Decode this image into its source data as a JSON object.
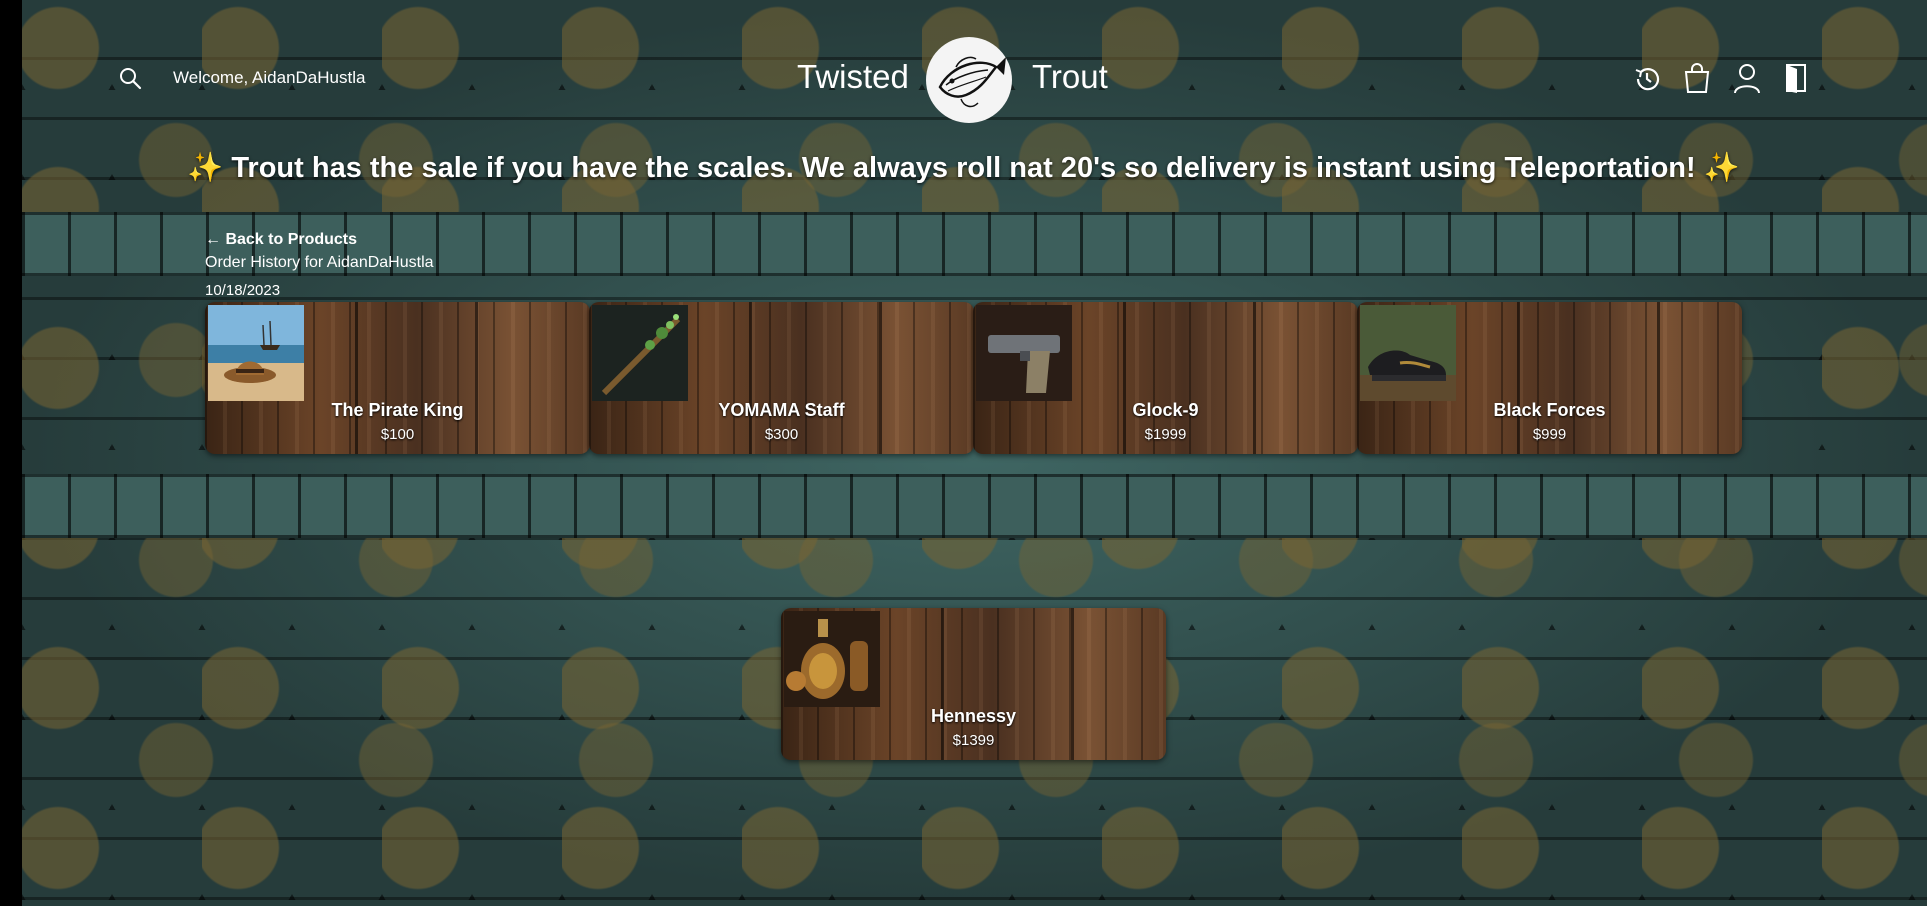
{
  "header": {
    "welcome": "Welcome, AidanDaHustla",
    "brand_left": "Twisted",
    "brand_right": "Trout",
    "icons": [
      "search-icon",
      "history-icon",
      "shopping-bag-icon",
      "user-icon",
      "logout-door-icon"
    ]
  },
  "tagline": "✨ Trout has the sale if you have the scales. We always roll nat 20's so delivery is instant using Teleportation! ✨",
  "nav": {
    "back_label": "← Back to Products",
    "history_title": "Order History for AidanDaHustla"
  },
  "order": {
    "date": "10/18/2023",
    "items": [
      {
        "name": "The Pirate King",
        "price": "$100"
      },
      {
        "name": "YOMAMA Staff",
        "price": "$300"
      },
      {
        "name": "Glock-9",
        "price": "$1999"
      },
      {
        "name": "Black Forces",
        "price": "$999"
      },
      {
        "name": "Hennessy",
        "price": "$1399"
      }
    ]
  },
  "colors": {
    "text": "#ffffff",
    "stone": "#2e4a49",
    "wood": "#5b3a22"
  }
}
